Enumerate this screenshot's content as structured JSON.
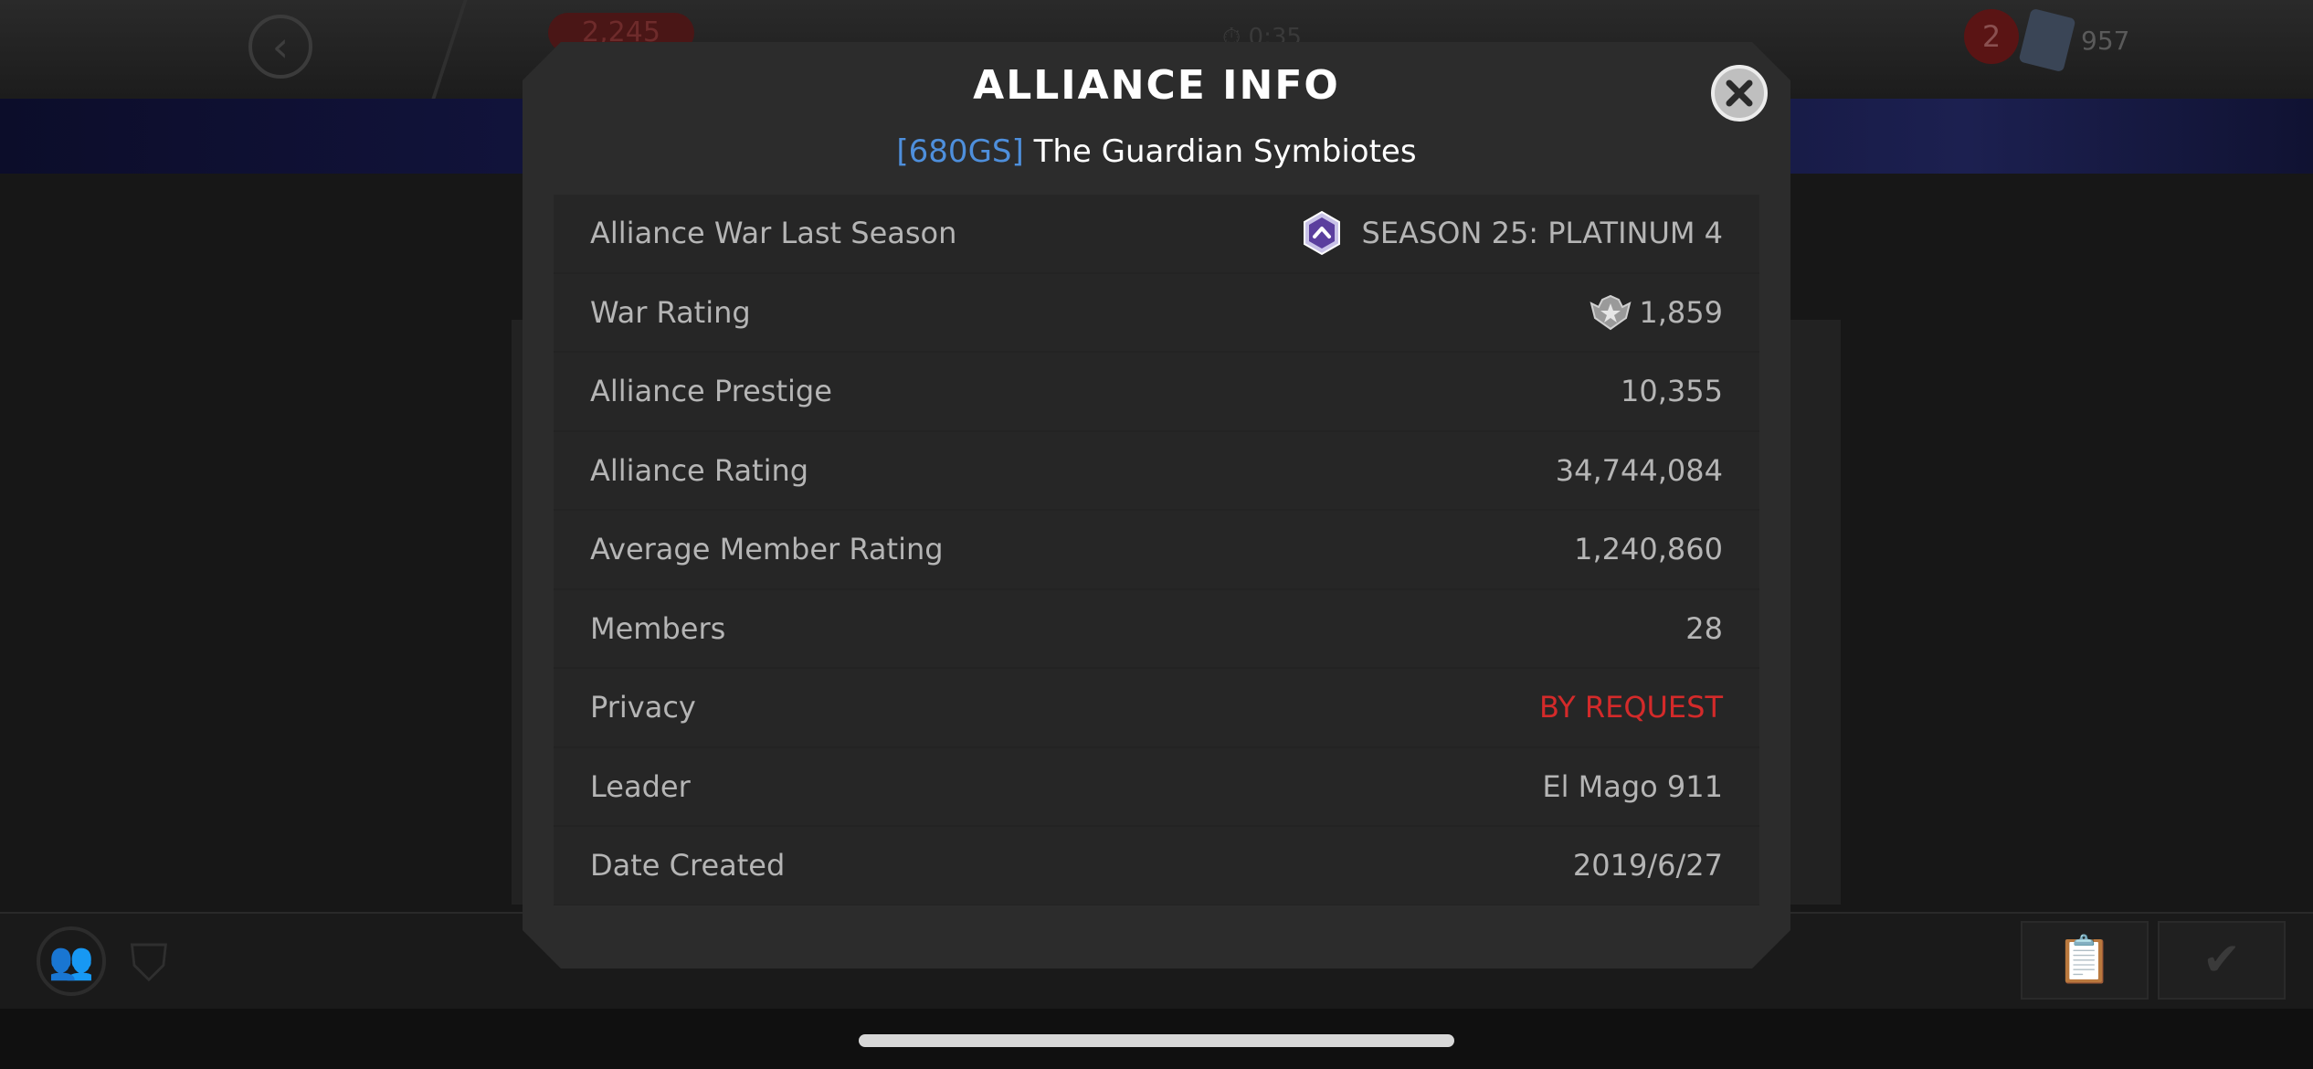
{
  "background": {
    "units_count": "2,245",
    "timer_text": "0:35",
    "notification_count": "2",
    "card_count": "957"
  },
  "modal": {
    "title": "ALLIANCE INFO",
    "alliance_tag": "[680GS]",
    "alliance_name": "The Guardian Symbiotes",
    "rows": [
      {
        "label": "Alliance War Last Season",
        "value": "SEASON 25: PLATINUM 4",
        "icon": "platinum-tier-icon"
      },
      {
        "label": "War Rating",
        "value": "1,859",
        "icon": "war-rating-icon"
      },
      {
        "label": "Alliance Prestige",
        "value": "10,355"
      },
      {
        "label": "Alliance Rating",
        "value": "34,744,084"
      },
      {
        "label": "Average Member Rating",
        "value": "1,240,860"
      },
      {
        "label": "Members",
        "value": "28"
      },
      {
        "label": "Privacy",
        "value": "BY REQUEST",
        "color": "#d42a2a"
      },
      {
        "label": "Leader",
        "value": "El Mago 911"
      },
      {
        "label": "Date Created",
        "value": "2019/6/27"
      }
    ]
  },
  "colors": {
    "tag_blue": "#4e8fdc",
    "privacy_red": "#d42a2a",
    "modal_bg": "#2c2c2c"
  }
}
